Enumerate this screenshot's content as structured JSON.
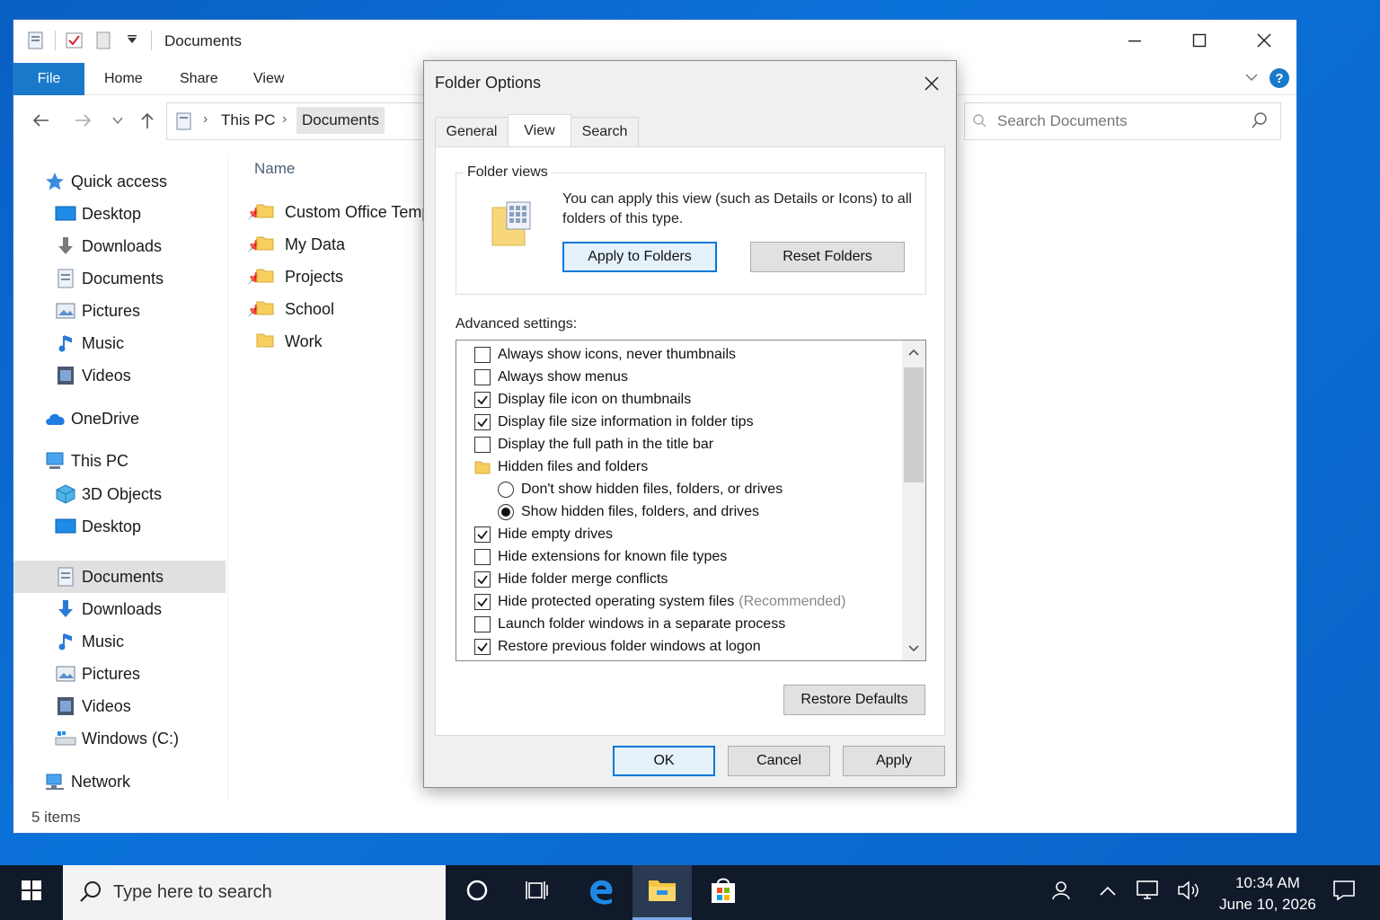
{
  "explorer": {
    "title": "Documents",
    "ribbon_tabs": [
      "File",
      "Home",
      "Share",
      "View"
    ],
    "address": {
      "root": "This PC",
      "current": "Documents"
    },
    "search_placeholder": "Search Documents",
    "sidebar": {
      "quick_access": "Quick access",
      "quick_items": [
        "Desktop",
        "Downloads",
        "Documents",
        "Pictures",
        "Music",
        "Videos"
      ],
      "onedrive": "OneDrive",
      "this_pc": "This PC",
      "pc_items": [
        "3D Objects",
        "Desktop",
        "Documents",
        "Downloads",
        "Music",
        "Pictures",
        "Videos",
        "Windows (C:)"
      ],
      "network": "Network"
    },
    "column_name": "Name",
    "files": [
      "Custom Office Templates",
      "My Data",
      "Projects",
      "School",
      "Work"
    ],
    "status": "5 items"
  },
  "dialog": {
    "title": "Folder Options",
    "tabs": [
      "General",
      "View",
      "Search"
    ],
    "folder_views": {
      "legend": "Folder views",
      "description": "You can apply this view (such as Details or Icons) to all folders of this type.",
      "apply_button": "Apply to Folders",
      "reset_button": "Reset Folders"
    },
    "advanced_label": "Advanced settings:",
    "settings": [
      {
        "label": "Always show icons, never thumbnails",
        "type": "checkbox",
        "checked": false
      },
      {
        "label": "Always show menus",
        "type": "checkbox",
        "checked": false
      },
      {
        "label": "Display file icon on thumbnails",
        "type": "checkbox",
        "checked": true
      },
      {
        "label": "Display file size information in folder tips",
        "type": "checkbox",
        "checked": true
      },
      {
        "label": "Display the full path in the title bar",
        "type": "checkbox",
        "checked": false
      },
      {
        "label": "Hidden files and folders",
        "type": "folder"
      },
      {
        "label": "Don't show hidden files, folders, or drives",
        "type": "radio",
        "checked": false
      },
      {
        "label": "Show hidden files, folders, and drives",
        "type": "radio",
        "checked": true
      },
      {
        "label": "Hide empty drives",
        "type": "checkbox",
        "checked": true
      },
      {
        "label": "Hide extensions for known file types",
        "type": "checkbox",
        "checked": false
      },
      {
        "label": "Hide folder merge conflicts",
        "type": "checkbox",
        "checked": true
      },
      {
        "label": "Hide protected operating system files",
        "suffix": "(Recommended)",
        "type": "checkbox",
        "checked": true
      },
      {
        "label": "Launch folder windows in a separate process",
        "type": "checkbox",
        "checked": false
      },
      {
        "label": "Restore previous folder windows at logon",
        "type": "checkbox",
        "checked": true
      }
    ],
    "restore_defaults": "Restore Defaults",
    "ok": "OK",
    "cancel": "Cancel",
    "apply": "Apply"
  },
  "taskbar": {
    "search_placeholder": "Type here to search",
    "time": "10:34 AM",
    "date": "June 10, 2026"
  },
  "colors": {
    "accent": "#1979ca",
    "taskbar": "#101a2a",
    "desktop": "#0b6fd6"
  }
}
